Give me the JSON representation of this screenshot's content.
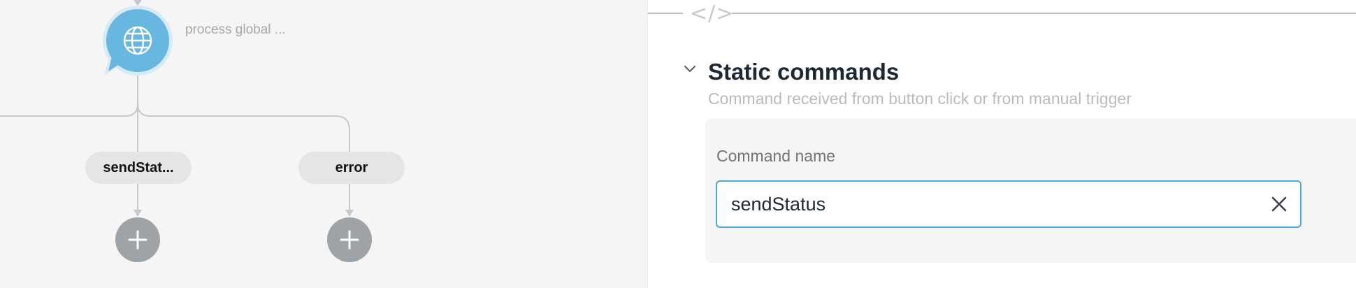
{
  "canvas": {
    "root_node": {
      "icon": "globe-icon",
      "label": "process global ..."
    },
    "branches": [
      {
        "label": "sendStat...",
        "add_icon": "plus-icon"
      },
      {
        "label": "error",
        "add_icon": "plus-icon"
      }
    ]
  },
  "panel": {
    "divider_icon": "code-icon",
    "divider_glyph": "</>",
    "section": {
      "toggle_icon": "chevron-down-icon",
      "title": "Static commands",
      "subtitle": "Command received from button click or from manual trigger"
    },
    "field": {
      "label": "Command name",
      "value": "sendStatus",
      "clear_icon": "close-icon"
    }
  },
  "colors": {
    "node_blue": "#67b7e1",
    "input_border": "#4aa8d8",
    "connector": "#c3c9ce",
    "add_node": "#9ea3a8"
  }
}
